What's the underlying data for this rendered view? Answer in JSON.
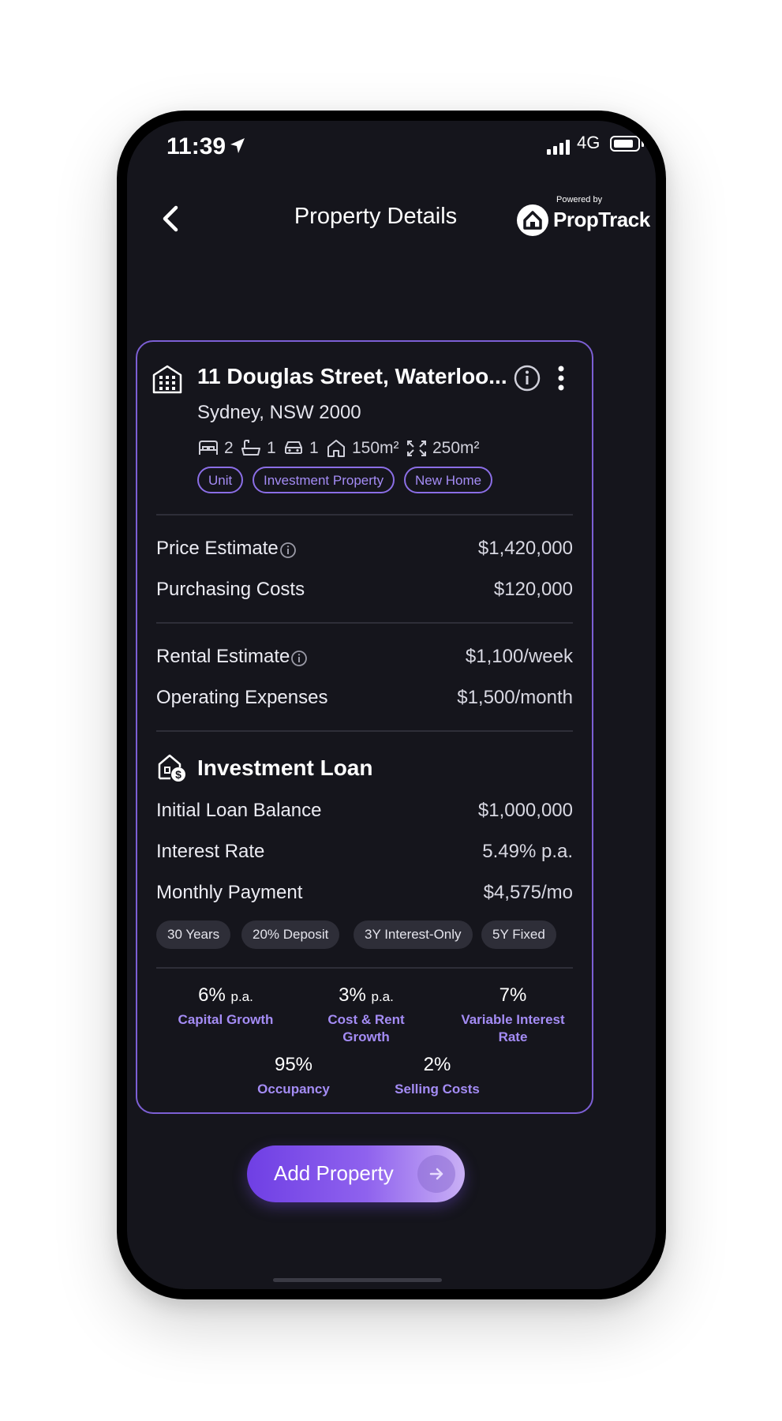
{
  "status_bar": {
    "time": "11:39",
    "network": "4G"
  },
  "header": {
    "title": "Property Details",
    "powered_by": "Powered by",
    "brand": "PropTrack"
  },
  "property": {
    "address": "11 Douglas Street, Waterloo...",
    "city": "Sydney, NSW 2000",
    "features": {
      "beds": "2",
      "baths": "1",
      "cars": "1",
      "house_area": "150m²",
      "land_area": "250m²"
    },
    "tags": [
      "Unit",
      "Investment Property",
      "New Home"
    ]
  },
  "costs": [
    {
      "label": "Price Estimate",
      "value": "$1,420,000"
    },
    {
      "label": "Purchasing Costs",
      "value": "$120,000"
    }
  ],
  "income": [
    {
      "label": "Rental Estimate",
      "value": "$1,100/week"
    },
    {
      "label": "Operating Expenses",
      "value": "$1,500/month"
    }
  ],
  "loan": {
    "title": "Investment Loan",
    "rows": [
      {
        "label": "Initial Loan Balance",
        "value": "$1,000,000"
      },
      {
        "label": "Interest Rate",
        "value": "5.49% p.a."
      },
      {
        "label": "Monthly Payment",
        "value": "$4,575/mo"
      }
    ],
    "pills": [
      "30 Years",
      "20% Deposit",
      "3Y Interest-Only",
      "5Y Fixed"
    ]
  },
  "assumptions": [
    {
      "value": "6%",
      "unit": "p.a.",
      "label1": "Capital Growth",
      "label2": ""
    },
    {
      "value": "3%",
      "unit": "p.a.",
      "label1": "Cost & Rent",
      "label2": "Growth"
    },
    {
      "value": "7%",
      "unit": "",
      "label1": "Variable Interest",
      "label2": "Rate"
    },
    {
      "value": "95%",
      "unit": "",
      "label1": "Occupancy",
      "label2": ""
    },
    {
      "value": "2%",
      "unit": "",
      "label1": "Selling Costs",
      "label2": ""
    }
  ],
  "cta": {
    "label": "Add Property"
  },
  "colors": {
    "accent": "#8b6ee6",
    "background": "#15151c",
    "card_border": "#7c5fd4"
  }
}
